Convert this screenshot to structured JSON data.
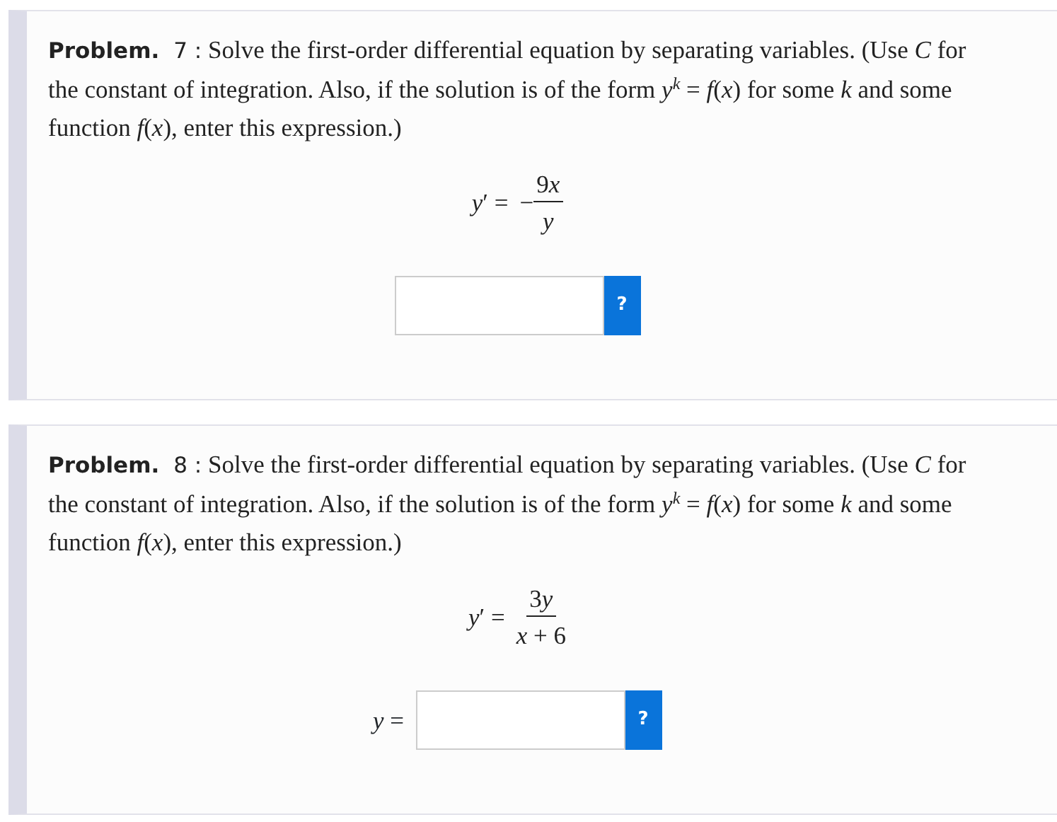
{
  "problems": [
    {
      "label": "Problem.",
      "number": "7 :",
      "statement": "Solve the first-order differential equation by separating variables. (Use *C* for the constant of integration. Also, if the solution is of the form *y*$^{k}$ = *f*(*x*) for some *k* and some function *f*(*x*), enter this expression.)",
      "equation": {
        "lhs": "*y*′ =",
        "sign": "−",
        "numerator": [
          {
            "kind": "num",
            "text": "9"
          },
          {
            "kind": "var",
            "text": "x"
          }
        ],
        "denominator": [
          {
            "kind": "var",
            "text": "y"
          }
        ]
      },
      "answer": {
        "help": "?"
      }
    },
    {
      "label": "Problem.",
      "number": "8 :",
      "statement": "Solve the first-order differential equation by separating variables. (Use *C* for the constant of integration. Also, if the solution is of the form *y*$^{k}$ = *f*(*x*) for some *k* and some function *f*(*x*), enter this expression.)",
      "equation": {
        "lhs": "*y*′ =",
        "numerator": [
          {
            "kind": "num",
            "text": "3"
          },
          {
            "kind": "var",
            "text": "y"
          }
        ],
        "denominator": [
          {
            "kind": "var",
            "text": "x"
          },
          {
            "kind": "num",
            "text": " + 6"
          }
        ]
      },
      "answer": {
        "prefix": "*y* =",
        "help": "?"
      }
    }
  ]
}
